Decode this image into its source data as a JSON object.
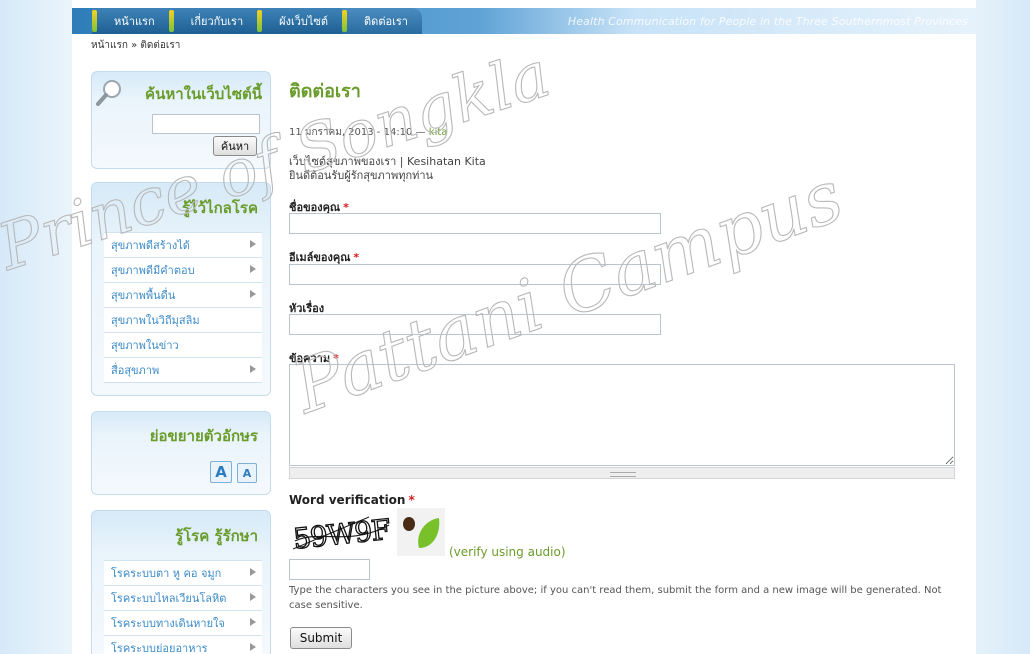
{
  "nav": {
    "items": [
      {
        "label": "หน้าแรก"
      },
      {
        "label": "เกี่ยวกับเรา"
      },
      {
        "label": "ผังเว็บไซต์"
      },
      {
        "label": "ติดต่อเรา"
      }
    ],
    "tagline": "Health Communication for People in the Three Southernmost Provinces"
  },
  "breadcrumb": {
    "home": "หน้าแรก",
    "separator": "»",
    "current": "ติดต่อเรา"
  },
  "sidebar": {
    "search": {
      "title": "ค้นหาในเว็บไซต์นี้",
      "button": "ค้นหา",
      "value": ""
    },
    "health": {
      "title": "รู้ไว้ไกลโรค",
      "items": [
        {
          "label": "สุขภาพดีสร้างได้",
          "arrow": true
        },
        {
          "label": "สุขภาพดีมีคำตอบ",
          "arrow": true
        },
        {
          "label": "สุขภาพพื้นดื่น",
          "arrow": true
        },
        {
          "label": "สุขภาพในวิถีมุสลิม",
          "arrow": false
        },
        {
          "label": "สุขภาพในข่าว",
          "arrow": false
        },
        {
          "label": "สื่อสุขภาพ",
          "arrow": true
        }
      ]
    },
    "fontsize": {
      "title": "ย่อขยายตัวอักษร",
      "increase": "A",
      "decrease": "A"
    },
    "disease": {
      "title": "รู้โรค รู้รักษา",
      "items": [
        {
          "label": "โรคระบบตา หู คอ จมูก",
          "arrow": true
        },
        {
          "label": "โรคระบบไหลเวียนโลหิต",
          "arrow": true
        },
        {
          "label": "โรคระบบทางเดินหายใจ",
          "arrow": true
        },
        {
          "label": "โรคระบบย่อยอาหาร",
          "arrow": true
        }
      ]
    }
  },
  "main": {
    "title": "ติดต่อเรา",
    "meta": {
      "date": "11 มกราคม, 2013 - 14:10 —",
      "author": "kita"
    },
    "intro": [
      "เว็บไซต์สุขภาพของเรา | Kesihatan Kita",
      "ยินดีต้อนรับผู้รักสุขภาพทุกท่าน"
    ],
    "form": {
      "name_label": "ชื่อของคุณ",
      "email_label": "อีเมล์ของคุณ",
      "subject_label": "หัวเรื่อง",
      "message_label": "ข้อความ",
      "required_mark": "*",
      "captcha_label": "Word verification",
      "captcha_text": "59W9F",
      "audio_link": "(verify using audio)",
      "help": "Type the characters you see in the picture above; if you can't read them, submit the form and a new image will be generated. Not case sensitive.",
      "submit": "Submit"
    }
  },
  "watermark": {
    "line1": "Prince of Songkla",
    "line2": "Pattani Campus"
  },
  "colors": {
    "accent_green": "#6a9c2b",
    "link_blue": "#3c8bc8",
    "required_red": "#d21c1c"
  }
}
